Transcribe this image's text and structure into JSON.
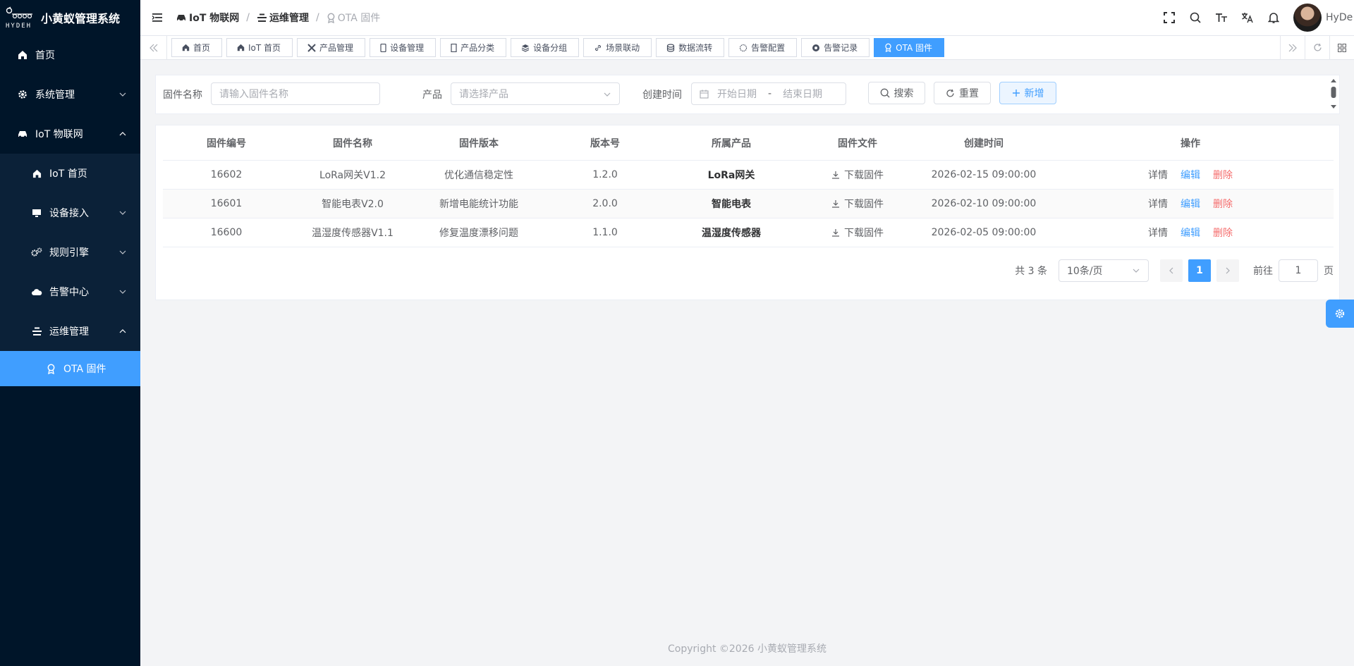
{
  "app": {
    "title": "小黄蚁管理系统",
    "logo_text": "HYDEH",
    "accent_color": "#409eff",
    "sidebar_bg": "#001529"
  },
  "sidebar": {
    "items": [
      {
        "label": "首页",
        "icon": "home-icon"
      },
      {
        "label": "系统管理",
        "icon": "gear-icon"
      },
      {
        "label": "IoT 物联网",
        "icon": "car-icon"
      },
      {
        "label": "IoT 首页",
        "icon": "home-icon"
      },
      {
        "label": "设备接入",
        "icon": "monitor-icon"
      },
      {
        "label": "规则引擎",
        "icon": "gears-icon"
      },
      {
        "label": "告警中心",
        "icon": "cloud-icon"
      },
      {
        "label": "运维管理",
        "icon": "ops-icon"
      },
      {
        "label": "OTA 固件",
        "icon": "medal-icon"
      }
    ]
  },
  "header": {
    "breadcrumb": [
      "IoT 物联网",
      "运维管理",
      "OTA 固件"
    ],
    "username": "HyDe"
  },
  "tags": [
    {
      "label": "首页",
      "icon": "home-icon"
    },
    {
      "label": "IoT 首页",
      "icon": "home-icon"
    },
    {
      "label": "产品管理",
      "icon": "tools-icon"
    },
    {
      "label": "设备管理",
      "icon": "phone-icon"
    },
    {
      "label": "产品分类",
      "icon": "tablet-icon"
    },
    {
      "label": "设备分组",
      "icon": "layers-icon"
    },
    {
      "label": "场景联动",
      "icon": "link-icon"
    },
    {
      "label": "数据流转",
      "icon": "coin-icon"
    },
    {
      "label": "告警配置",
      "icon": "alarm-config-icon"
    },
    {
      "label": "告警记录",
      "icon": "record-icon"
    },
    {
      "label": "OTA 固件",
      "icon": "medal-icon",
      "active": true
    }
  ],
  "search": {
    "firmware_name_label": "固件名称",
    "firmware_name_placeholder": "请输入固件名称",
    "product_label": "产品",
    "product_placeholder": "请选择产品",
    "created_label": "创建时间",
    "start_placeholder": "开始日期",
    "date_sep": "-",
    "end_placeholder": "结束日期",
    "search_btn": "搜索",
    "reset_btn": "重置",
    "add_btn": "新增"
  },
  "table": {
    "columns": [
      "固件编号",
      "固件名称",
      "固件版本",
      "版本号",
      "所属产品",
      "固件文件",
      "创建时间",
      "操作"
    ],
    "download_label": "下载固件",
    "op_detail": "详情",
    "op_edit": "编辑",
    "op_delete": "删除",
    "rows": [
      {
        "id": "16602",
        "name": "LoRa网关V1.2",
        "version_desc": "优化通信稳定性",
        "version": "1.2.0",
        "product": "LoRa网关",
        "created": "2026-02-15 09:00:00"
      },
      {
        "id": "16601",
        "name": "智能电表V2.0",
        "version_desc": "新增电能统计功能",
        "version": "2.0.0",
        "product": "智能电表",
        "created": "2026-02-10 09:00:00"
      },
      {
        "id": "16600",
        "name": "温湿度传感器V1.1",
        "version_desc": "修复温度漂移问题",
        "version": "1.1.0",
        "product": "温湿度传感器",
        "created": "2026-02-05 09:00:00"
      }
    ]
  },
  "pagination": {
    "total_text": "共 3 条",
    "page_size": "10条/页",
    "current_page": "1",
    "goto_prefix": "前往",
    "goto_value": "1",
    "goto_suffix": "页"
  },
  "footer": {
    "copyright": "Copyright ©2026 小黄蚁管理系统"
  }
}
